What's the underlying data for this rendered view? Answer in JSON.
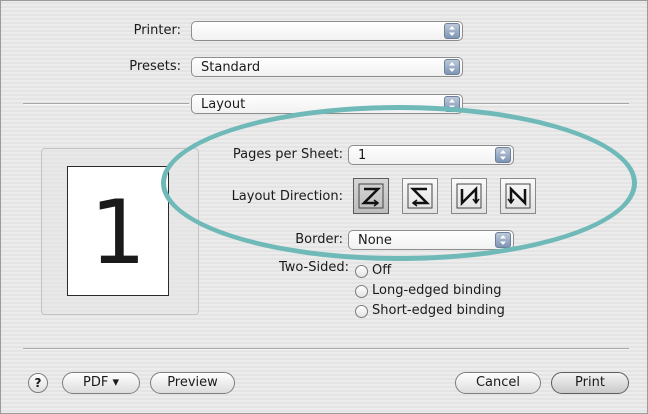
{
  "printer": {
    "label": "Printer:",
    "value": ""
  },
  "presets": {
    "label": "Presets:",
    "value": "Standard"
  },
  "panel_select": {
    "value": "Layout"
  },
  "preview": {
    "page_number": "1"
  },
  "pages_per_sheet": {
    "label": "Pages per Sheet:",
    "value": "1"
  },
  "layout_direction": {
    "label": "Layout Direction:",
    "options": [
      "left-right-top-bottom",
      "right-left-top-bottom",
      "top-bottom-left-right",
      "top-bottom-right-left"
    ],
    "selected_index": 0
  },
  "border": {
    "label": "Border:",
    "value": "None"
  },
  "two_sided": {
    "label": "Two-Sided:",
    "options": [
      "Off",
      "Long-edged binding",
      "Short-edged binding"
    ]
  },
  "footer": {
    "help": "?",
    "pdf": "PDF ▾",
    "preview": "Preview",
    "cancel": "Cancel",
    "print": "Print"
  },
  "colors": {
    "annotation_oval": "#6fb9b8",
    "arrows_blue": "#7f95b6"
  },
  "icons": [
    "popup-arrows-icon",
    "z-order-icon",
    "s-order-icon",
    "n-order-icon",
    "reverse-n-order-icon",
    "help-icon"
  ]
}
